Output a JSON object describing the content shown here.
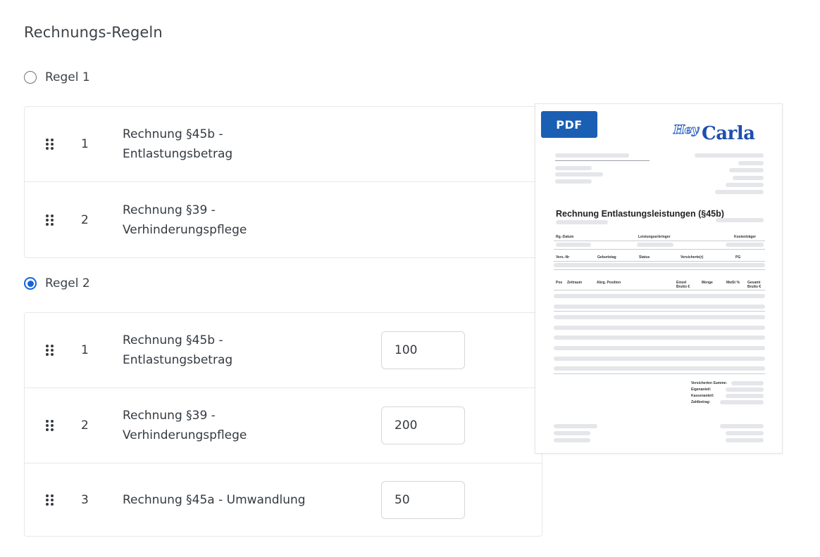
{
  "page": {
    "title": "Rechnungs-Regeln"
  },
  "rules": [
    {
      "label": "Regel 1",
      "selected": false,
      "items": [
        {
          "num": "1",
          "line1": "Rechnung §45b -",
          "line2": "Entlastungsbetrag"
        },
        {
          "num": "2",
          "line1": "Rechnung §39 -",
          "line2": "Verhinderungspflege"
        }
      ]
    },
    {
      "label": "Regel 2",
      "selected": true,
      "items": [
        {
          "num": "1",
          "line1": "Rechnung §45b -",
          "line2": "Entlastungsbetrag",
          "value": "100"
        },
        {
          "num": "2",
          "line1": "Rechnung §39 -",
          "line2": "Verhinderungspflege",
          "value": "200"
        },
        {
          "num": "3",
          "line1": "Rechnung §45a - Umwandlung",
          "line2": "",
          "value": "50"
        }
      ]
    }
  ],
  "pdf_preview": {
    "badge": "PDF",
    "logo_hey": "Hey",
    "logo_carla": "Carla",
    "heading": "Rechnung Entlastungsleistungen (§45b)",
    "row1_headers": [
      "Rg.-Datum",
      "Leistungserbringer",
      "Kostenträger"
    ],
    "row2_headers": [
      "Vers.-Nr",
      "Geburtstag",
      "Status",
      "Versicherte(r)",
      "PG"
    ],
    "table_headers": [
      "Pos",
      "Zeitraum",
      "Abrg. Position",
      "Einzel Brutto €",
      "Menge",
      "MwSt %",
      "Gesamt Brutto €"
    ],
    "summary_labels": [
      "Versicherten Summe:",
      "Eigenanteil:",
      "Kassenanteil:",
      "Zahlbetrag:"
    ]
  },
  "colors": {
    "accent": "#1565d8",
    "pdf_badge": "#1a5fb4",
    "logo_blue": "#1d4fae",
    "border": "#e6e8eb",
    "text": "#343a40"
  }
}
